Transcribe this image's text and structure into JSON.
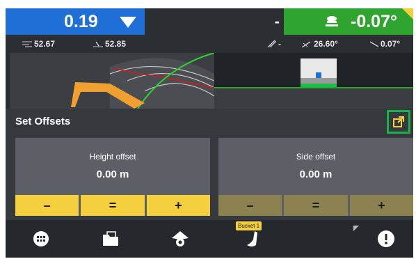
{
  "height_tile": {
    "value": "0.19",
    "left_reading": "52.67",
    "right_reading": "52.85",
    "color": "#1f6fd6"
  },
  "middle_tile": {
    "value": "-",
    "sub_value": "-"
  },
  "slope_tile": {
    "value": "-0.07°",
    "left_reading": "26.60°",
    "right_reading": "0.07°",
    "color": "#2fa52f"
  },
  "offsets": {
    "title": "Set Offsets",
    "height": {
      "label": "Height offset",
      "value": "0.00 m",
      "minus": "–",
      "equals": "=",
      "plus": "+"
    },
    "side": {
      "label": "Side offset",
      "value": "0.00 m",
      "minus": "–",
      "equals": "=",
      "plus": "+"
    }
  },
  "bottom_bar": {
    "bucket_label": "Bucket 1",
    "icons": [
      "keypad-icon",
      "folder-icon",
      "camera-view-icon",
      "bucket-icon",
      "alert-icon"
    ]
  },
  "colors": {
    "accent_yellow": "#f4d03f",
    "accent_green": "#19b34a",
    "panel": "#35393e"
  }
}
